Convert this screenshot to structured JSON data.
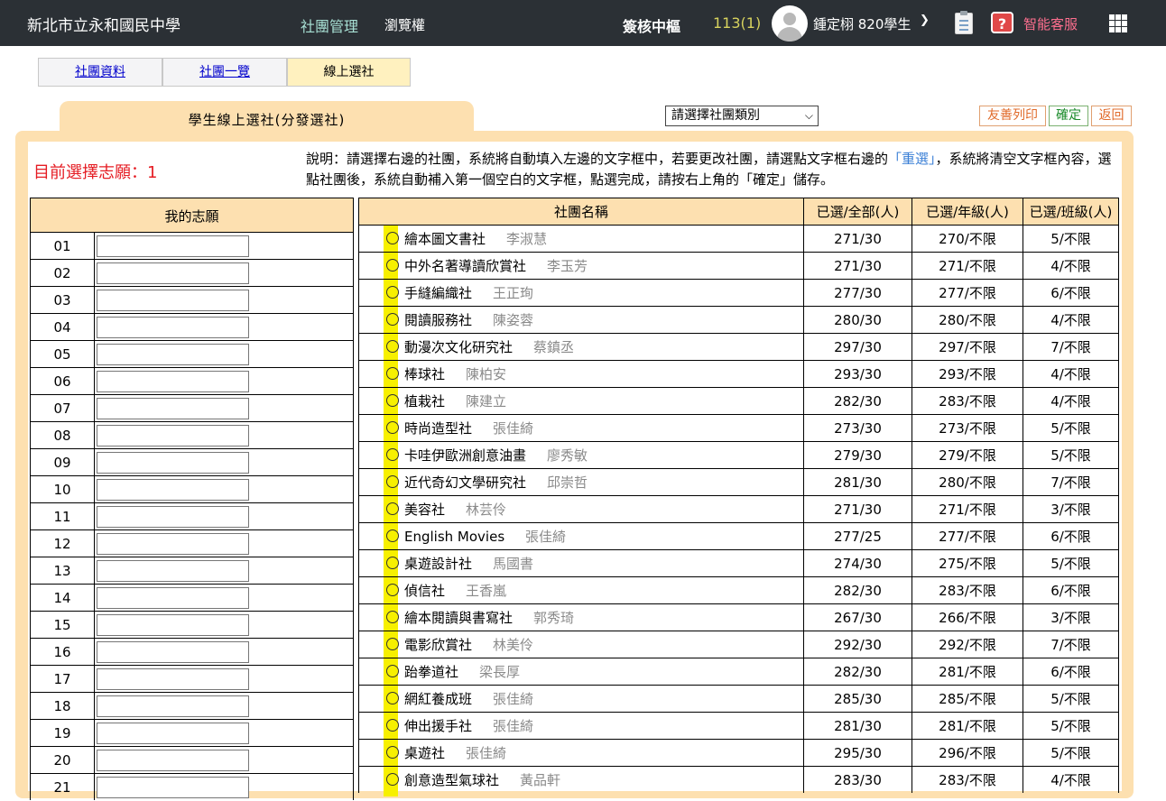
{
  "header": {
    "school_name": "新北市立永和國民中學",
    "nav_club_admin": "社團管理",
    "nav_browse": "瀏覽權",
    "hub": "簽核中樞",
    "term": "113(1)",
    "user": "鍾定栩 820學生",
    "service": "智能客服"
  },
  "tabs": [
    "社團資料",
    "社團一覽",
    "線上選社"
  ],
  "panel": {
    "title": "學生線上選社(分發選社)",
    "category_placeholder": "請選擇社團類別",
    "buttons": {
      "print": "友善列印",
      "confirm": "確定",
      "back": "返回"
    },
    "current_choice_label": "目前選擇志願：1",
    "desc_part1": "說明：請選擇右邊的社團，系統將自動填入左邊的文字框中，若要更改社團，請選點文字框右邊的",
    "desc_link": "「重選」",
    "desc_part2": "，系統將清空文字框內容，選點社團後，系統自動補入第一個空白的文字框，點選完成，請按右上角的「確定」儲存。"
  },
  "wish_table": {
    "header": "我的志願",
    "numbers": [
      "01",
      "02",
      "03",
      "04",
      "05",
      "06",
      "07",
      "08",
      "09",
      "10",
      "11",
      "12",
      "13",
      "14",
      "15",
      "16",
      "17",
      "18",
      "19",
      "20",
      "21"
    ]
  },
  "club_table": {
    "headers": [
      "社團名稱",
      "已選/全部(人)",
      "已選/年級(人)",
      "已選/班級(人)"
    ],
    "rows": [
      {
        "name": "繪本圖文書社",
        "teacher": "李淑慧",
        "all": "271/30",
        "grade": "270/不限",
        "class": "5/不限"
      },
      {
        "name": "中外名著導讀欣賞社",
        "teacher": "李玉芳",
        "all": "271/30",
        "grade": "271/不限",
        "class": "4/不限"
      },
      {
        "name": "手縫編織社",
        "teacher": "王正珣",
        "all": "277/30",
        "grade": "277/不限",
        "class": "6/不限"
      },
      {
        "name": "閱讀服務社",
        "teacher": "陳姿蓉",
        "all": "280/30",
        "grade": "280/不限",
        "class": "4/不限"
      },
      {
        "name": "動漫次文化研究社",
        "teacher": "蔡鎮丞",
        "all": "297/30",
        "grade": "297/不限",
        "class": "7/不限"
      },
      {
        "name": "棒球社",
        "teacher": "陳柏安",
        "all": "293/30",
        "grade": "293/不限",
        "class": "4/不限"
      },
      {
        "name": "植栽社",
        "teacher": "陳建立",
        "all": "282/30",
        "grade": "283/不限",
        "class": "4/不限"
      },
      {
        "name": "時尚造型社",
        "teacher": "張佳綺",
        "all": "273/30",
        "grade": "273/不限",
        "class": "5/不限"
      },
      {
        "name": "卡哇伊歐洲創意油畫",
        "teacher": "廖秀敏",
        "all": "279/30",
        "grade": "279/不限",
        "class": "5/不限"
      },
      {
        "name": "近代奇幻文學研究社",
        "teacher": "邱崇哲",
        "all": "281/30",
        "grade": "280/不限",
        "class": "7/不限"
      },
      {
        "name": "美容社",
        "teacher": "林芸伶",
        "all": "271/30",
        "grade": "271/不限",
        "class": "3/不限"
      },
      {
        "name": "English Movies",
        "teacher": "張佳綺",
        "all": "277/25",
        "grade": "277/不限",
        "class": "6/不限"
      },
      {
        "name": "桌遊設計社",
        "teacher": "馬國書",
        "all": "274/30",
        "grade": "275/不限",
        "class": "5/不限"
      },
      {
        "name": "偵信社",
        "teacher": "王香嵐",
        "all": "282/30",
        "grade": "283/不限",
        "class": "6/不限"
      },
      {
        "name": "繪本閱讀與書寫社",
        "teacher": "郭秀琦",
        "all": "267/30",
        "grade": "266/不限",
        "class": "3/不限"
      },
      {
        "name": "電影欣賞社",
        "teacher": "林美伶",
        "all": "292/30",
        "grade": "292/不限",
        "class": "7/不限"
      },
      {
        "name": "跆拳道社",
        "teacher": "梁長厚",
        "all": "282/30",
        "grade": "281/不限",
        "class": "6/不限"
      },
      {
        "name": "網紅養成班",
        "teacher": "張佳綺",
        "all": "285/30",
        "grade": "285/不限",
        "class": "5/不限"
      },
      {
        "name": "伸出援手社",
        "teacher": "張佳綺",
        "all": "281/30",
        "grade": "281/不限",
        "class": "5/不限"
      },
      {
        "name": "桌遊社",
        "teacher": "張佳綺",
        "all": "295/30",
        "grade": "296/不限",
        "class": "5/不限"
      },
      {
        "name": "創意造型氣球社",
        "teacher": "黃品軒",
        "all": "283/30",
        "grade": "283/不限",
        "class": "4/不限"
      }
    ]
  }
}
